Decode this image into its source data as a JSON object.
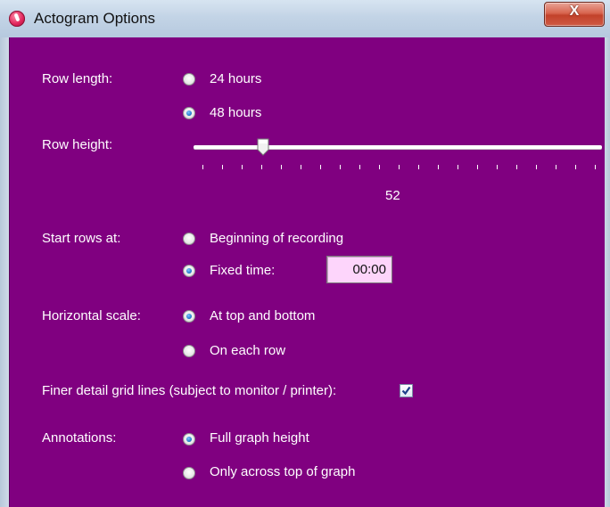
{
  "window": {
    "title": "Actogram Options",
    "close_glyph": "X"
  },
  "row_length": {
    "label": "Row length:",
    "options": [
      {
        "label": "24 hours",
        "checked": false
      },
      {
        "label": "48 hours",
        "checked": true
      }
    ]
  },
  "row_height": {
    "label": "Row height:",
    "value": "52",
    "slider_fraction": 0.17
  },
  "start_rows": {
    "label": "Start rows at:",
    "options": [
      {
        "label": "Beginning of recording",
        "checked": false
      },
      {
        "label": "Fixed time:",
        "checked": true
      }
    ],
    "fixed_time": "00:00"
  },
  "horizontal_scale": {
    "label": "Horizontal scale:",
    "options": [
      {
        "label": "At top and bottom",
        "checked": true
      },
      {
        "label": "On each row",
        "checked": false
      }
    ]
  },
  "finer_grid": {
    "label": "Finer detail grid lines (subject to monitor / printer):",
    "checked": true
  },
  "annotations": {
    "label": "Annotations:",
    "options": [
      {
        "label": "Full graph height",
        "checked": true
      },
      {
        "label": "Only across top of graph",
        "checked": false
      }
    ]
  },
  "colors": {
    "background": "#800080",
    "accent": "#1c6fc8",
    "input_bg": "#fdd5fb"
  }
}
